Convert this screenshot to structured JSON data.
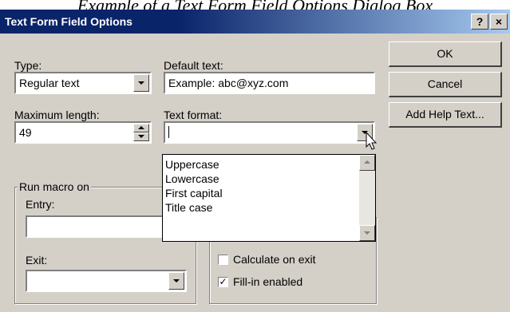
{
  "caption": "Example of a Text Form Field Options Dialog Box",
  "window": {
    "title": "Text Form Field Options",
    "help_glyph": "?",
    "close_glyph": "×"
  },
  "type": {
    "label": "Type:",
    "value": "Regular text"
  },
  "default_text": {
    "label": "Default text:",
    "value": "Example: abc@xyz.com"
  },
  "max_length": {
    "label": "Maximum length:",
    "value": "49"
  },
  "text_format": {
    "label": "Text format:",
    "value": "",
    "options": [
      "Uppercase",
      "Lowercase",
      "First capital",
      "Title case"
    ]
  },
  "run_macro": {
    "label": "Run macro on",
    "entry_label": "Entry:",
    "exit_label": "Exit:",
    "entry_value": "",
    "exit_value": ""
  },
  "field_settings": {
    "calculate_on_exit_label": "Calculate on exit",
    "calculate_on_exit_checked": false,
    "fill_in_enabled_label": "Fill-in enabled",
    "fill_in_enabled_checked": true,
    "check_mark": "✓"
  },
  "buttons": {
    "ok": "OK",
    "cancel": "Cancel",
    "add_help_text": "Add Help Text..."
  }
}
